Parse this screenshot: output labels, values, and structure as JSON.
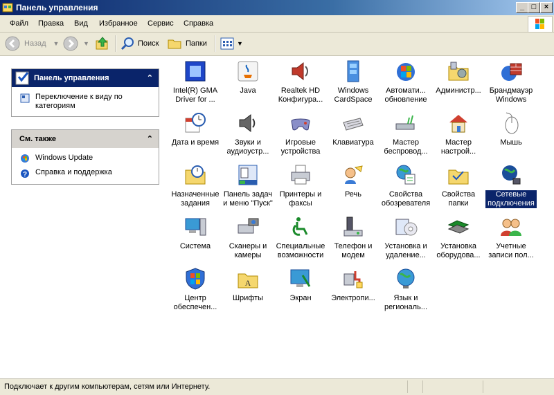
{
  "window": {
    "title": "Панель управления"
  },
  "menu": [
    "Файл",
    "Правка",
    "Вид",
    "Избранное",
    "Сервис",
    "Справка"
  ],
  "toolbar": {
    "back": "Назад",
    "search": "Поиск",
    "folders": "Папки"
  },
  "sidebar": {
    "control_panel": {
      "title": "Панель управления",
      "switch_link": "Переключение к виду по категориям"
    },
    "see_also": {
      "title": "См. также",
      "links": [
        "Windows Update",
        "Справка и поддержка"
      ]
    }
  },
  "items": [
    [
      "Intel(R) GMA Driver for ...",
      "Java",
      "Realtek HD Конфигура...",
      "Windows CardSpace",
      "Автомати... обновление",
      "Администр...",
      "Брандмауэр Windows"
    ],
    [
      "Дата и время",
      "Звуки и аудиоустр...",
      "Игровые устройства",
      "Клавиатура",
      "Мастер беспровод...",
      "Мастер настрой...",
      "Мышь"
    ],
    [
      "Назначенные задания",
      "Панель задач и меню \"Пуск\"",
      "Принтеры и факсы",
      "Речь",
      "Свойства обозревателя",
      "Свойства папки",
      "Сетевые подключения"
    ],
    [
      "Система",
      "Сканеры и камеры",
      "Специальные возможности",
      "Телефон и модем",
      "Установка и удаление...",
      "Установка оборудова...",
      "Учетные записи пол..."
    ],
    [
      "Центр обеспечен...",
      "Шрифты",
      "Экран",
      "Электропи...",
      "Язык и региональ..."
    ]
  ],
  "selected_item": "Сетевые подключения",
  "status": {
    "text": "Подключает к другим компьютерам, сетям или Интернету."
  },
  "colors": {
    "titlebar": "#0a246a",
    "selection": "#0a246a",
    "chrome": "#ece9d8"
  }
}
